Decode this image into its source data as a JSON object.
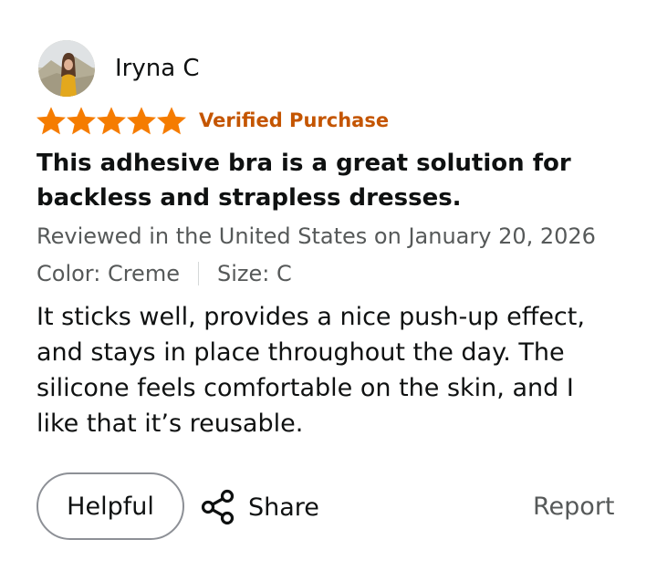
{
  "reviewer": {
    "name": "Iryna C"
  },
  "rating": {
    "stars": 5,
    "max": 5,
    "color": "#f57c00"
  },
  "badge": {
    "verified_label": "Verified Purchase",
    "color": "#c45500"
  },
  "review": {
    "title": "This adhesive bra is a great solution for backless and strapless dresses.",
    "meta": "Reviewed in the United States on January 20, 2026",
    "color": "Color: Creme",
    "size": "Size: C",
    "body": "It sticks well, provides a nice push-up effect, and stays in place throughout the day. The silicone feels comfortable on the skin, and I like that it’s reusable."
  },
  "actions": {
    "helpful_label": "Helpful",
    "share_label": "Share",
    "report_label": "Report"
  },
  "icons": {
    "share": "share-icon",
    "star": "star-icon",
    "avatar": "avatar"
  }
}
